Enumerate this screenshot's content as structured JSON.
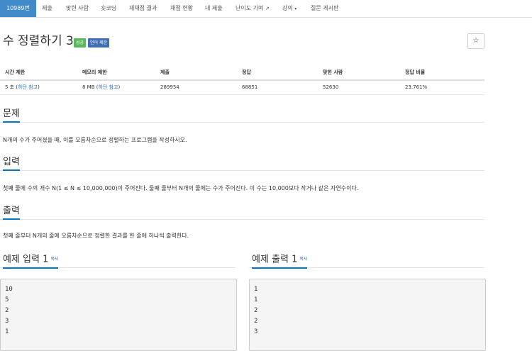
{
  "nav": {
    "items": [
      {
        "label": "10989번",
        "active": true
      },
      {
        "label": "제출"
      },
      {
        "label": "맞힌 사람"
      },
      {
        "label": "숏코딩"
      },
      {
        "label": "재채점 결과"
      },
      {
        "label": "채점 현황"
      },
      {
        "label": "내 제출"
      },
      {
        "label": "난이도 기여"
      },
      {
        "label": "강의"
      },
      {
        "label": "질문 게시판"
      }
    ],
    "ext_icon": "↗",
    "caret_icon": "▾"
  },
  "problem": {
    "title": "수 정렬하기 3",
    "badge_success": "성공",
    "badge_limit": "언어 제한",
    "star_icon": "☆"
  },
  "stats": {
    "headers": [
      "시간 제한",
      "메모리 제한",
      "제출",
      "정답",
      "맞힌 사람",
      "정답 비율"
    ],
    "time_limit": "5 초",
    "memory_limit": "8 MB",
    "note_open": "(",
    "note_link": "하단 참고",
    "note_close": ")",
    "submissions": "289954",
    "correct": "68851",
    "solvers": "52630",
    "ratio": "23.761%"
  },
  "sections": {
    "problem_heading": "문제",
    "problem_text": "N개의 수가 주어졌을 때, 이를 오름차순으로 정렬하는 프로그램을 작성하시오.",
    "input_heading": "입력",
    "input_text": "첫째 줄에 수의 개수 N(1 ≤ N ≤ 10,000,000)이 주어진다. 둘째 줄부터 N개의 줄에는 수가 주어진다. 이 수는 10,000보다 작거나 같은 자연수이다.",
    "output_heading": "출력",
    "output_text": "첫째 줄부터 N개의 줄에 오름차순으로 정렬한 결과를 한 줄에 하나씩 출력한다."
  },
  "samples": {
    "input_title": "예제 입력 1",
    "output_title": "예제 출력 1",
    "copy_label": "복사",
    "input_lines": [
      "10",
      "5",
      "2",
      "3",
      "1"
    ],
    "output_lines": [
      "1",
      "1",
      "2",
      "2",
      "3"
    ]
  }
}
